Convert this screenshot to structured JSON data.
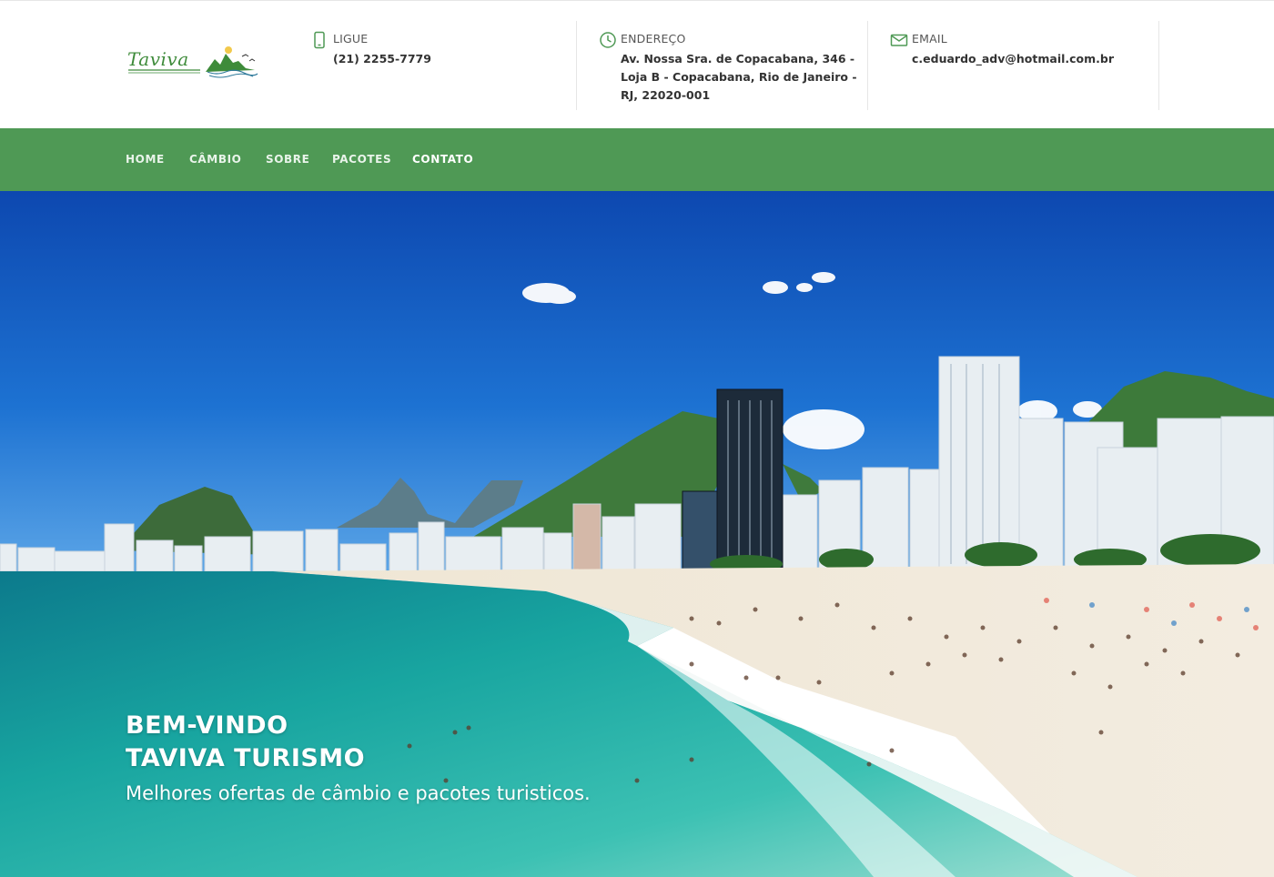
{
  "header": {
    "logo": {
      "text": "Taviva"
    },
    "contacts": [
      {
        "icon": "phone-icon",
        "title": "LIGUE",
        "lines": [
          "(21) 2255-7779"
        ]
      },
      {
        "icon": "clock-icon",
        "title": "ENDEREÇO",
        "lines": [
          "Av. Nossa Sra. de Copacabana, 346 -",
          "Loja B - Copacabana, Rio de Janeiro -",
          "RJ, 22020-001"
        ]
      },
      {
        "icon": "email-icon",
        "title": "EMAIL",
        "lines": [
          "c.eduardo_adv@hotmail.com.br"
        ]
      }
    ]
  },
  "nav": {
    "items": [
      {
        "label": "HOME"
      },
      {
        "label": "CÂMBIO"
      },
      {
        "label": "SOBRE"
      },
      {
        "label": "PACOTES"
      },
      {
        "label": "CONTATO",
        "active": true
      }
    ]
  },
  "hero": {
    "title_line1": "BEM-VINDO",
    "title_line2": "TAVIVA TURISMO",
    "subtitle": "Melhores ofertas de câmbio e pacotes turisticos."
  },
  "colors": {
    "brand_green": "#4f9955",
    "logo_green": "#3e8b3a",
    "icon_green": "#4f9955"
  }
}
